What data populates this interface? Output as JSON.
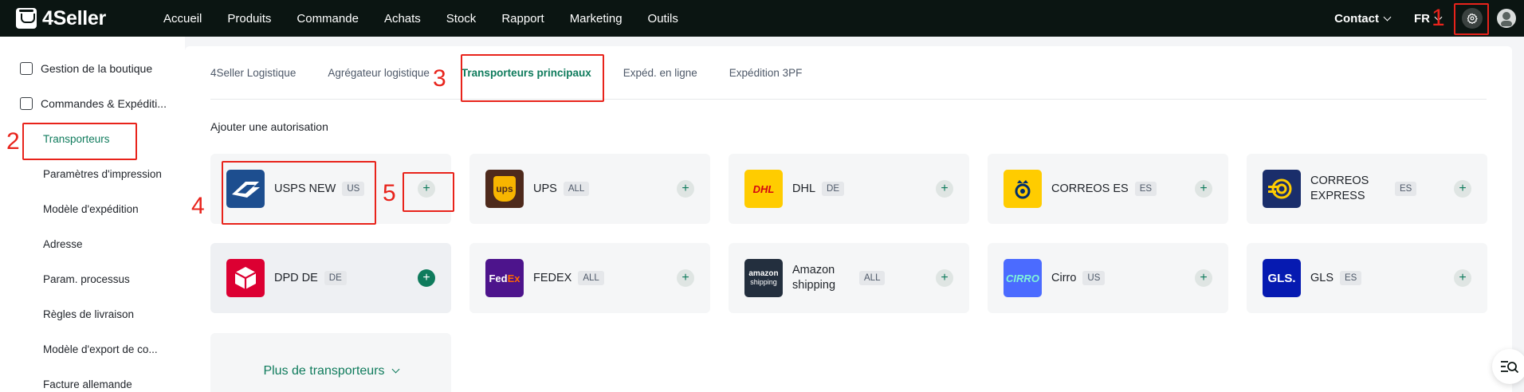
{
  "app": {
    "logo_text": "4Seller"
  },
  "nav": {
    "items": [
      "Accueil",
      "Produits",
      "Commande",
      "Achats",
      "Stock",
      "Rapport",
      "Marketing",
      "Outils"
    ],
    "contact": "Contact",
    "lang": "FR"
  },
  "sidebar": {
    "groups": [
      "Gestion de la boutique",
      "Commandes & Expéditi..."
    ],
    "items": [
      "Transporteurs",
      "Paramètres d'impression",
      "Modèle d'expédition",
      "Adresse",
      "Param. processus",
      "Règles de livraison",
      "Modèle d'export de co...",
      "Facture allemande"
    ],
    "active_item": "Transporteurs"
  },
  "tabs": [
    "4Seller Logistique",
    "Agrégateur logistique",
    "Transporteurs principaux",
    "Expéd. en ligne",
    "Expédition 3PF"
  ],
  "active_tab": "Transporteurs principaux",
  "section_title": "Ajouter une autorisation",
  "carriers": [
    {
      "name": "USPS NEW",
      "badge": "US",
      "logo": "usps-logo"
    },
    {
      "name": "UPS",
      "badge": "ALL",
      "logo": "ups-logo"
    },
    {
      "name": "DHL",
      "badge": "DE",
      "logo": "dhl-logo"
    },
    {
      "name": "CORREOS ES",
      "badge": "ES",
      "logo": "correos-logo"
    },
    {
      "name": "CORREOS EXPRESS",
      "badge": "ES",
      "logo": "correos-express-logo"
    },
    {
      "name": "DPD DE",
      "badge": "DE",
      "logo": "dpd-logo"
    },
    {
      "name": "FEDEX",
      "badge": "ALL",
      "logo": "fedex-logo"
    },
    {
      "name": "Amazon shipping",
      "badge": "ALL",
      "logo": "amazon-shipping-logo"
    },
    {
      "name": "Cirro",
      "badge": "US",
      "logo": "cirro-logo"
    },
    {
      "name": "GLS",
      "badge": "ES",
      "logo": "gls-logo"
    }
  ],
  "logo_text": {
    "ups": "ups",
    "dhl": "DHL",
    "fedex_fed": "Fed",
    "fedex_ex": "Ex",
    "amazon_line1": "amazon",
    "amazon_line2": "shipping",
    "cirro": "CIRRO",
    "gls": "GLS."
  },
  "more_carriers": "Plus de transporteurs",
  "add_symbol": "+",
  "annotations": [
    "1",
    "2",
    "3",
    "4",
    "5"
  ],
  "colors": {
    "topbar": "#0b1512",
    "accent": "#0f7b5c",
    "annotation": "#e8231b",
    "usps": "#1d4e8f",
    "ups": "#4e2a1c",
    "dhl": "#ffcc00",
    "correos": "#ffcc00",
    "correos_express": "#1a2e6b",
    "dpd": "#dc0032",
    "fedex": "#4d148c",
    "amazon": "#232f3e",
    "cirro": "#4b6bff",
    "gls": "#061ab1"
  }
}
